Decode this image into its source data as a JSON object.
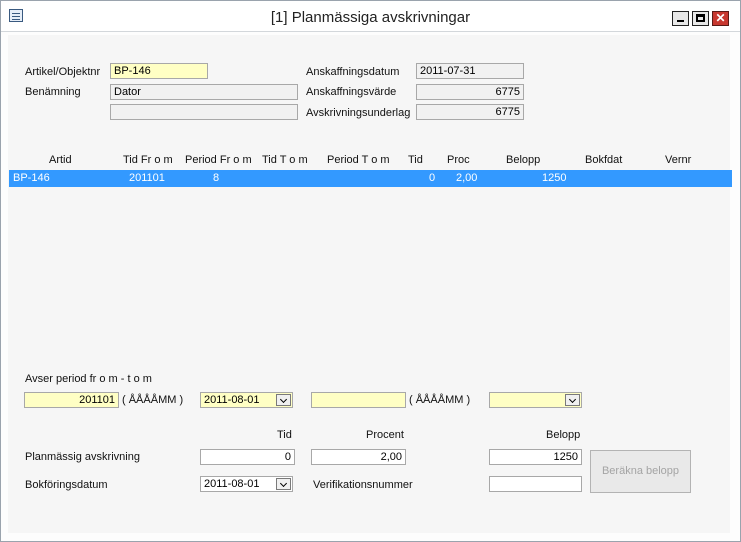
{
  "window": {
    "title": "[1]  Planmässiga avskrivningar"
  },
  "form": {
    "artikel_label": "Artikel/Objektnr",
    "artikel_value": "BP-146",
    "benamning_label": "Benämning",
    "benamning_value": "Dator",
    "benamning_extra": "",
    "anskaffningsdatum_label": "Anskaffningsdatum",
    "anskaffningsdatum_value": "2011-07-31",
    "anskaffningsvarde_label": "Anskaffningsvärde",
    "anskaffningsvarde_value": "6775",
    "avskrivningsunderlag_label": "Avskrivningsunderlag",
    "avskrivningsunderlag_value": "6775"
  },
  "table": {
    "columns": [
      "Artid",
      "Tid Fr o m",
      "Period Fr o m",
      "Tid T o m",
      "Period T o m",
      "Tid",
      "Proc",
      "Belopp",
      "Bokfdat",
      "Vernr"
    ],
    "rows": [
      {
        "artid": "BP-146",
        "tid_from": "201101",
        "period_from": "8",
        "tid": "0",
        "proc": "2,00",
        "belopp": "1250"
      }
    ]
  },
  "period": {
    "label": "Avser period fr o m - t o m",
    "from_value": "201101",
    "from_hint": "( ÅÅÅÅMM )",
    "from_date": "2011-08-01",
    "to_value": "",
    "to_hint": "( ÅÅÅÅMM )",
    "to_date": ""
  },
  "calc": {
    "tid_header": "Tid",
    "procent_header": "Procent",
    "belopp_header": "Belopp",
    "plan_label": "Planmässig avskrivning",
    "tid_value": "0",
    "procent_value": "2,00",
    "belopp_value": "1250",
    "bokforing_label": "Bokföringsdatum",
    "bokforing_value": "2011-08-01",
    "verifikation_label": "Verifikationsnummer",
    "verifikation_value": "",
    "berakna_button": "Beräkna belopp"
  },
  "icons": {
    "system": "window-menu-icon",
    "minimize": "minimize-icon",
    "maximize": "maximize-icon",
    "close": "close-icon",
    "dropdown": "chevron-down-icon"
  },
  "colors": {
    "selection": "#3399ff",
    "input_highlight": "#ffffc4",
    "close_button": "#c7372f"
  }
}
